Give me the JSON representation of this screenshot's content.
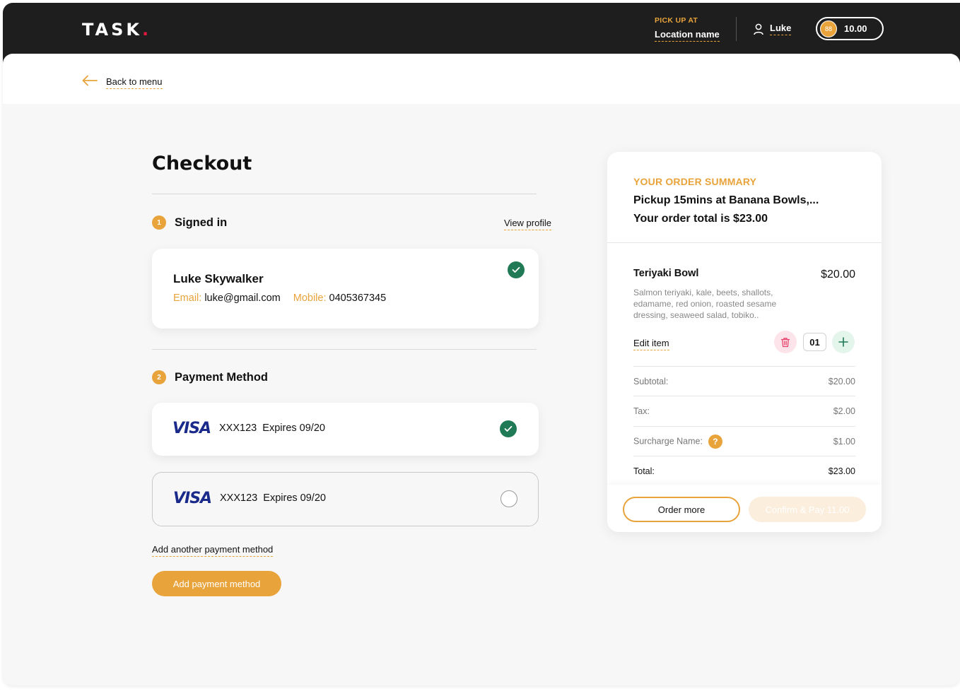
{
  "header": {
    "logo": "TASK",
    "logo_dot": ".",
    "pickup_label": "PICK UP AT",
    "location": "Location name",
    "user_name": "Luke",
    "coin": "88",
    "balance": "10.00"
  },
  "nav": {
    "back_label": "Back to menu"
  },
  "checkout": {
    "title": "Checkout",
    "signed_in": {
      "step": "1",
      "label": "Signed in",
      "view_profile": "View profile",
      "name": "Luke Skywalker",
      "email_label": "Email:",
      "email": "luke@gmail.com",
      "mobile_label": "Mobile:",
      "mobile": "0405367345"
    },
    "payment": {
      "step": "2",
      "label": "Payment Method",
      "cards": [
        {
          "brand": "VISA",
          "number": "XXX123",
          "expiry": "Expires 09/20",
          "selected": true
        },
        {
          "brand": "VISA",
          "number": "XXX123",
          "expiry": "Expires 09/20",
          "selected": false
        }
      ],
      "add_another": "Add another payment method",
      "add_button": "Add payment method"
    }
  },
  "summary": {
    "heading": "YOUR ORDER SUMMARY",
    "pickup": "Pickup 15mins at Banana Bowls,...",
    "total_line": "Your order total is $23.00",
    "item": {
      "name": "Teriyaki Bowl",
      "price": "$20.00",
      "description": "Salmon teriyaki, kale, beets, shallots, edamame, red onion, roasted sesame dressing, seaweed salad, tobiko..",
      "edit": "Edit item",
      "quantity": "01"
    },
    "rows": [
      {
        "label": "Subtotal:",
        "value": "$20.00"
      },
      {
        "label": "Tax:",
        "value": "$2.00"
      },
      {
        "label": "Surcharge Name:",
        "value": "$1.00"
      },
      {
        "label": "Total:",
        "value": "$23.00"
      }
    ],
    "order_more": "Order more",
    "confirm": "Confirm & Pay 11.00"
  },
  "colors": {
    "accent": "#e8a33b",
    "dark": "#1e1e1e",
    "success": "#1f7a55",
    "danger_bg": "#fde4ea",
    "brand_red": "#e0193f"
  },
  "icons": [
    "arrow-left-icon",
    "user-icon",
    "check-icon",
    "trash-icon",
    "plus-icon",
    "help-icon"
  ]
}
